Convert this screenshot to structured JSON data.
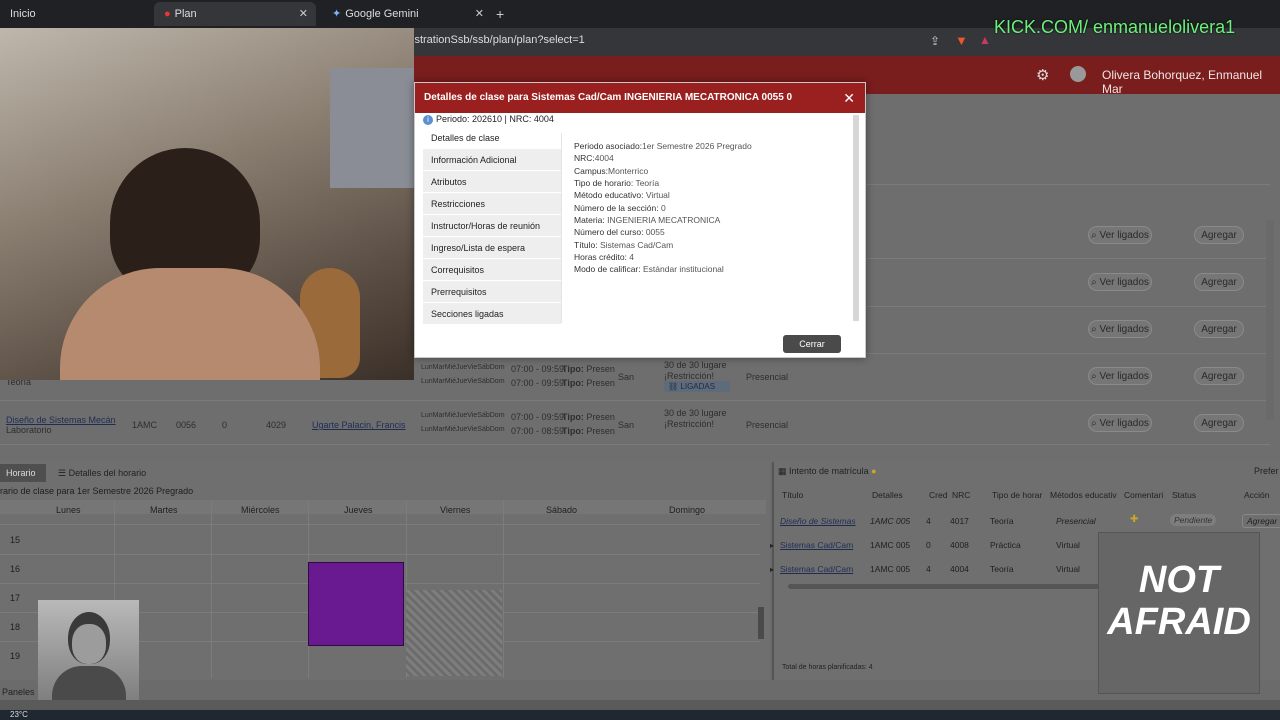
{
  "browser": {
    "tabs": [
      "Inicio",
      "Plan",
      "Google Gemini"
    ],
    "url": "istrationSsb/ssb/plan/plan?select=1",
    "overlay_text": "KICK.COM/ enmanuelolivera1"
  },
  "header": {
    "user_name": "Olivera Bohorquez, Enmanuel Mar"
  },
  "page_rows": [
    {
      "link_label": "Ver ligados",
      "add_label": "Agregar"
    },
    {
      "link_label": "Ver ligados",
      "add_label": "Agregar"
    },
    {
      "link_label": "Ver ligados",
      "add_label": "Agregar"
    },
    {
      "link_label": "Ver ligados",
      "add_label": "Agregar"
    },
    {
      "link_label": "Ver ligados",
      "add_label": "Agregar"
    }
  ],
  "row_partial": {
    "label": "Teoría",
    "days": "LunMarMiéJueVieSábDom",
    "time": "07:00 - 09:59",
    "tipo_label": "Tipo:",
    "tipo_value": "Presen",
    "campus_short": "San",
    "seats": "30 de 30 lugare",
    "restriction": "¡Restricción!",
    "ligadas": "LIGADAS",
    "mode": "Presencial"
  },
  "row_last": {
    "title": "Diseño de Sistemas Mecán",
    "subtitle": "Laboratorio",
    "section": "1AMC",
    "course": "0056",
    "credits": "0",
    "crn": "4029",
    "instructor": "Ugarte Palacin, Francis",
    "days": "LunMarMiéJueVieSábDom",
    "time": "07:00 - 08:59",
    "tipo_label": "Tipo:",
    "tipo_value": "Presen",
    "campus_short": "San",
    "seats": "30 de 30 lugare",
    "restriction": "¡Restricción!",
    "mode": "Presencial"
  },
  "modal": {
    "title": "Detalles de clase para Sistemas Cad/Cam INGENIERIA MECATRONICA 0055 0",
    "period_line": "Periodo: 202610 | NRC: 4004",
    "side_tabs": [
      "Detalles de clase",
      "Información Adicional",
      "Atributos",
      "Restricciones",
      "Instructor/Horas de reunión",
      "Ingreso/Lista de espera",
      "Correquisitos",
      "Prerrequisitos",
      "Secciones ligadas"
    ],
    "details": [
      {
        "label": "Periodo asociado:",
        "value": "1er Semestre 2026 Pregrado"
      },
      {
        "label": "NRC:",
        "value": "4004"
      },
      {
        "label": "Campus:",
        "value": "Monterrico"
      },
      {
        "label": "Tipo de horario:",
        "value": "Teoría"
      },
      {
        "label": "Método educativo:",
        "value": "Virtual"
      },
      {
        "label": "Número de la sección:",
        "value": "0"
      },
      {
        "label": "Materia:",
        "value": "INGENIERIA MECATRONICA"
      },
      {
        "label": "Número del curso:",
        "value": "0055"
      },
      {
        "label": "Título:",
        "value": "Sistemas Cad/Cam"
      },
      {
        "label": "Horas crédito:",
        "value": "4"
      },
      {
        "label": "Modo de calificar:",
        "value": "Estándar institucional"
      }
    ],
    "close_button": "Cerrar"
  },
  "schedule": {
    "tabs": [
      "Horario",
      "Detalles del horario"
    ],
    "title": "rario de clase para 1er Semestre 2026 Pregrado",
    "days": [
      "Lunes",
      "Martes",
      "Miércoles",
      "Jueves",
      "Viernes",
      "Sábado",
      "Domingo"
    ],
    "hours": [
      "15",
      "16",
      "17",
      "18",
      "19"
    ],
    "footer": "Paneles"
  },
  "registration": {
    "title": "Intento de matrícula",
    "pref": "Prefer",
    "headers": [
      "Título",
      "Detalles",
      "Cred",
      "NRC",
      "Tipo de horar",
      "Métodos educativ",
      "Comentari",
      "Status",
      "Acción"
    ],
    "rows": [
      {
        "title": "Diseño de Sistemas",
        "details": "1AMC 005",
        "cred": "4",
        "nrc": "4017",
        "type": "Teoría",
        "method": "Presencial",
        "status": "Pendiente",
        "action": "Agregar"
      },
      {
        "title": "Sistemas Cad/Cam",
        "details": "1AMC 005",
        "cred": "0",
        "nrc": "4008",
        "type": "Práctica",
        "method": "Virtual",
        "status": "",
        "action": ""
      },
      {
        "title": "Sistemas Cad/Cam",
        "details": "1AMC 005",
        "cred": "4",
        "nrc": "4004",
        "type": "Teoría",
        "method": "Virtual",
        "status": "",
        "action": ""
      }
    ],
    "total": "Total de horas planificadas: 4"
  },
  "overlay": {
    "badge_text": "NOT AFRAID"
  },
  "taskbar": {
    "temperature": "23°C"
  }
}
